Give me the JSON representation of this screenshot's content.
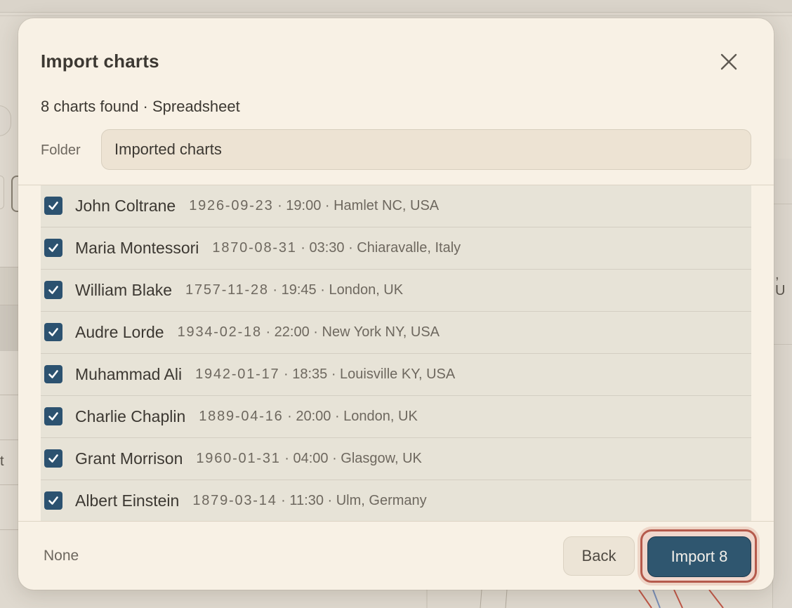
{
  "dialog": {
    "title": "Import charts",
    "close_icon": "close-icon",
    "subtitle": "8 charts found · Spreadsheet",
    "folder_label": "Folder",
    "folder_value": "Imported charts"
  },
  "charts": [
    {
      "name": "John Coltrane",
      "date": "1926-09-23",
      "details": " · 19:00 · Hamlet NC, USA",
      "checked": true
    },
    {
      "name": "Maria Montessori",
      "date": "1870-08-31",
      "details": " · 03:30 · Chiaravalle, Italy",
      "checked": true
    },
    {
      "name": "William Blake",
      "date": "1757-11-28",
      "details": " · 19:45 · London, UK",
      "checked": true
    },
    {
      "name": "Audre Lorde",
      "date": "1934-02-18",
      "details": " · 22:00 · New York NY, USA",
      "checked": true
    },
    {
      "name": "Muhammad Ali",
      "date": "1942-01-17",
      "details": " · 18:35 · Louisville KY, USA",
      "checked": true
    },
    {
      "name": "Charlie Chaplin",
      "date": "1889-04-16",
      "details": " · 20:00 · London, UK",
      "checked": true
    },
    {
      "name": "Grant Morrison",
      "date": "1960-01-31",
      "details": " · 04:00 · Glasgow, UK",
      "checked": true
    },
    {
      "name": "Albert Einstein",
      "date": "1879-03-14",
      "details": " · 11:30 · Ulm, Germany",
      "checked": true
    }
  ],
  "footer": {
    "none_label": "None",
    "back_label": "Back",
    "import_label": "Import 8"
  },
  "colors": {
    "accent": "#2f566f",
    "checkbox": "#2c5270",
    "focus_ring": "#b55a4c",
    "dialog_bg": "#f8f1e5"
  }
}
